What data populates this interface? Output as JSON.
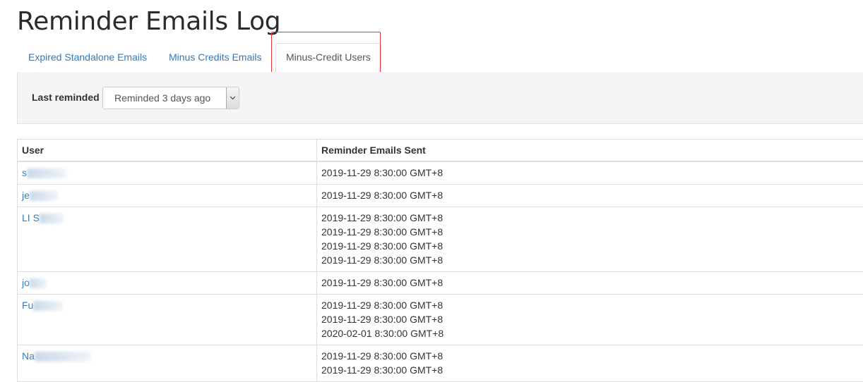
{
  "page": {
    "title": "Reminder Emails Log"
  },
  "tabs": [
    {
      "label": "Expired Standalone Emails",
      "active": false
    },
    {
      "label": "Minus Credits Emails",
      "active": false
    },
    {
      "label": "Minus-Credit Users",
      "active": true
    }
  ],
  "filter": {
    "label": "Last reminded",
    "selected": "Reminded 3 days ago"
  },
  "table": {
    "columns": [
      "User",
      "Reminder Emails Sent"
    ],
    "rows": [
      {
        "user": "s",
        "sent": [
          "2019-11-29 8:30:00 GMT+8"
        ]
      },
      {
        "user": "je",
        "sent": [
          "2019-11-29 8:30:00 GMT+8"
        ]
      },
      {
        "user": "LI   S",
        "sent": [
          "2019-11-29 8:30:00 GMT+8",
          "2019-11-29 8:30:00 GMT+8",
          "2019-11-29 8:30:00 GMT+8",
          "2019-11-29 8:30:00 GMT+8"
        ]
      },
      {
        "user": "jo",
        "sent": [
          "2019-11-29 8:30:00 GMT+8"
        ]
      },
      {
        "user": "Fu",
        "sent": [
          "2019-11-29 8:30:00 GMT+8",
          "2019-11-29 8:30:00 GMT+8",
          "2020-02-01 8:30:00 GMT+8"
        ]
      },
      {
        "user": "Na",
        "sent": [
          "2019-11-29 8:30:00 GMT+8",
          "2019-11-29 8:30:00 GMT+8"
        ]
      }
    ]
  },
  "colors": {
    "link": "#337ab7",
    "highlight": "#e0383e"
  }
}
